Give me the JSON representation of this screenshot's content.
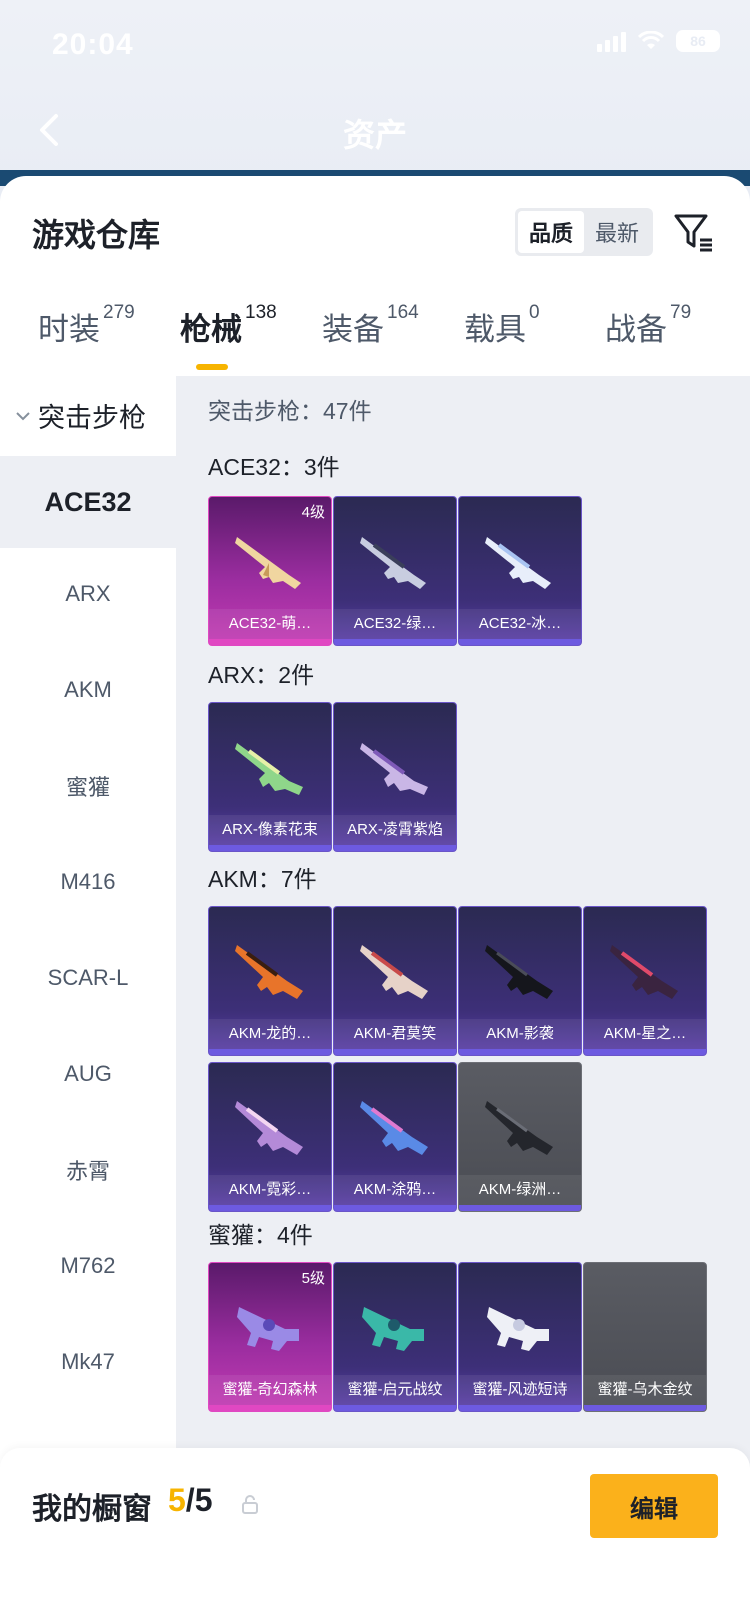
{
  "status": {
    "time": "20:04",
    "battery": "86"
  },
  "nav": {
    "title": "资产"
  },
  "sheet": {
    "title": "游戏仓库"
  },
  "sort": {
    "options": [
      "品质",
      "最新"
    ],
    "active": "品质"
  },
  "tabs": [
    {
      "label": "时装",
      "count": "279"
    },
    {
      "label": "枪械",
      "count": "138"
    },
    {
      "label": "装备",
      "count": "164"
    },
    {
      "label": "载具",
      "count": "0"
    },
    {
      "label": "战备",
      "count": "79"
    }
  ],
  "sidebar": {
    "heading": "突击步枪",
    "items": [
      "ACE32",
      "ARX",
      "AKM",
      "蜜獾",
      "M416",
      "SCAR-L",
      "AUG",
      "赤霄",
      "M762",
      "Mk47"
    ]
  },
  "content": {
    "total": "突击步枪：47件",
    "groups": [
      {
        "title": "ACE32：3件",
        "items": [
          {
            "name": "ACE32-萌…",
            "level": "4级",
            "rarity": "pink"
          },
          {
            "name": "ACE32-绿…",
            "rarity": "purple"
          },
          {
            "name": "ACE32-冰…",
            "rarity": "purple"
          }
        ]
      },
      {
        "title": "ARX：2件",
        "items": [
          {
            "name": "ARX-像素花束",
            "rarity": "purple"
          },
          {
            "name": "ARX-凌霄紫焰",
            "rarity": "purple"
          }
        ]
      },
      {
        "title": "AKM：7件",
        "items": [
          {
            "name": "AKM-龙的…",
            "rarity": "purple"
          },
          {
            "name": "AKM-君莫笑",
            "rarity": "purple"
          },
          {
            "name": "AKM-影袭",
            "rarity": "purple"
          },
          {
            "name": "AKM-星之…",
            "rarity": "purple"
          },
          {
            "name": "AKM-霓彩…",
            "rarity": "purple"
          },
          {
            "name": "AKM-涂鸦…",
            "rarity": "purple"
          },
          {
            "name": "AKM-绿洲…",
            "rarity": "grey"
          }
        ]
      },
      {
        "title": "蜜獾：4件",
        "items": [
          {
            "name": "蜜獾-奇幻森林",
            "level": "5级",
            "rarity": "pink"
          },
          {
            "name": "蜜獾-启元战纹",
            "rarity": "purple"
          },
          {
            "name": "蜜獾-风迹短诗",
            "rarity": "purple"
          },
          {
            "name": "蜜獾-乌木金纹",
            "rarity": "grey"
          }
        ]
      }
    ]
  },
  "bottom": {
    "label": "我的橱窗",
    "count_current": "5",
    "count_total": "/5",
    "edit_label": "编辑"
  },
  "colors": {
    "accent": "#fbb11b",
    "tab_indicator": "#f7b400",
    "purple_card": "#3d2f78",
    "pink_card": "#c33bb3"
  }
}
